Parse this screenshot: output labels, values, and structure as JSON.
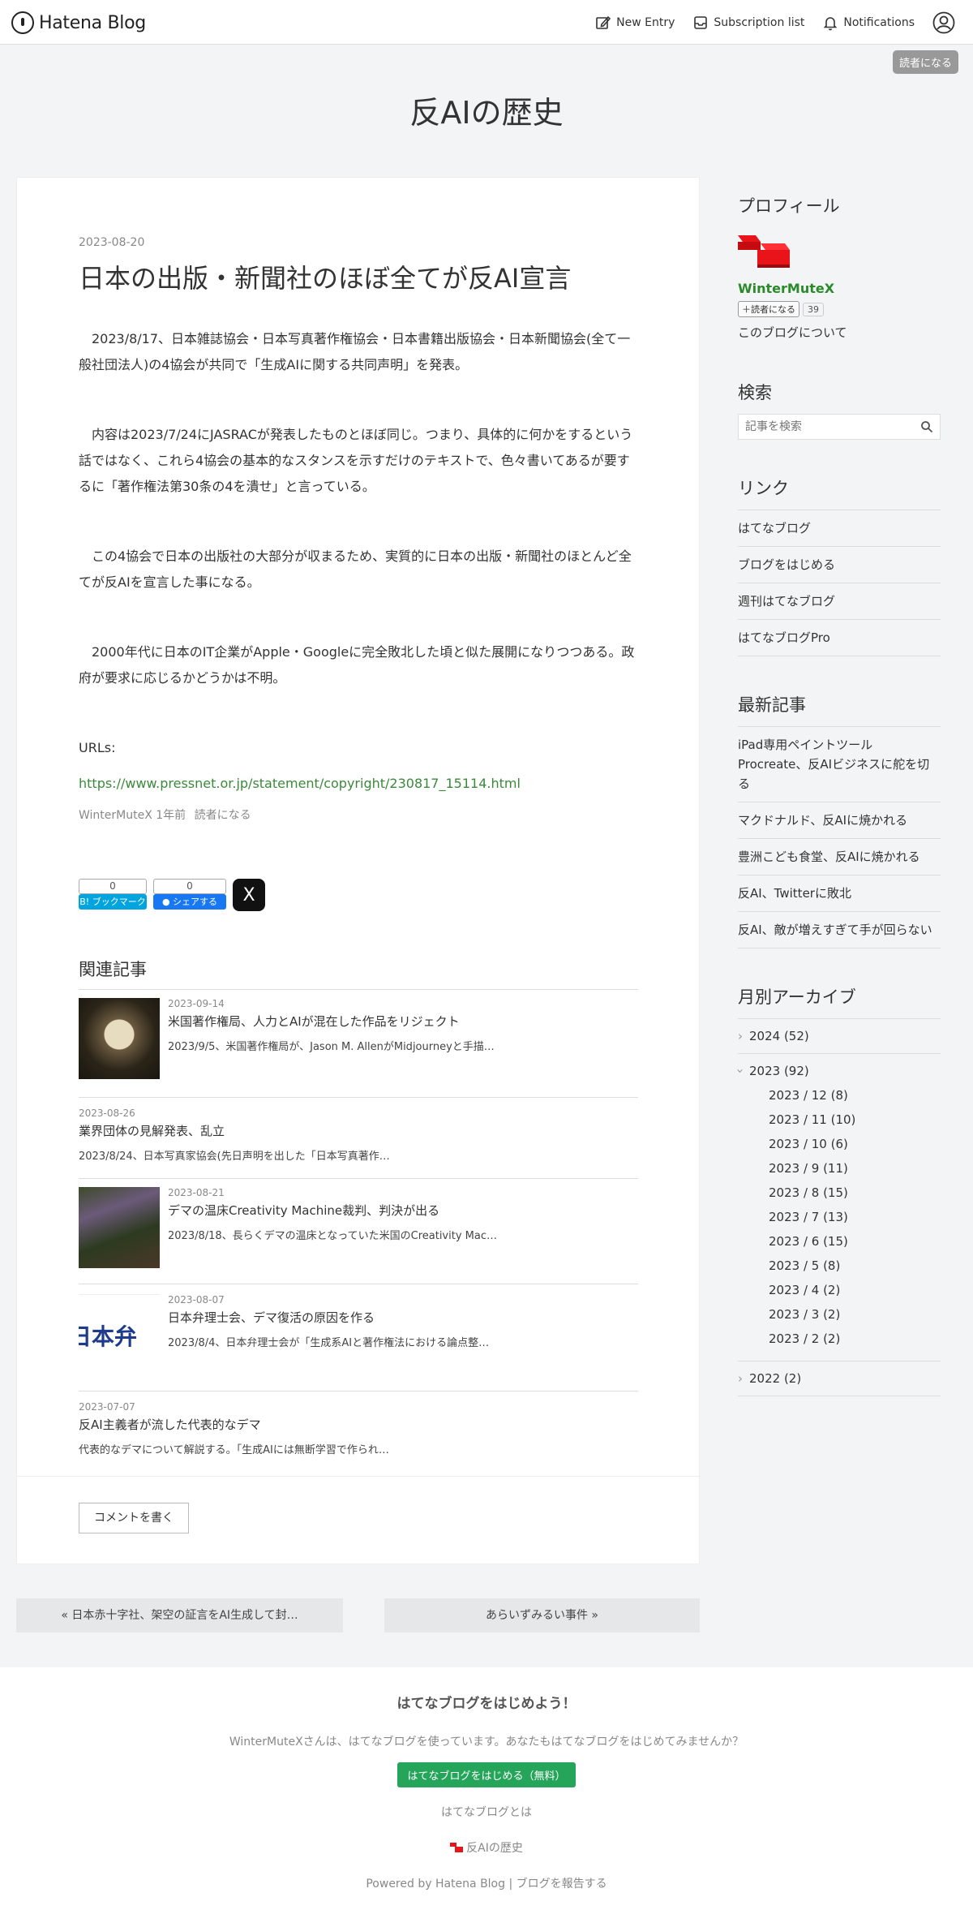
{
  "header": {
    "logo": "Hatena Blog",
    "new_entry": "New Entry",
    "subscription_list": "Subscription list",
    "notifications": "Notifications"
  },
  "subscribe_float": "読者になる",
  "blog_title": "反AIの歴史",
  "entry": {
    "date": "2023-08-20",
    "title": "日本の出版・新聞社のほぼ全てが反AI宣言",
    "paragraphs": [
      "　2023/8/17、日本雑誌協会・日本写真著作権協会・日本書籍出版協会・日本新聞協会(全て一般社団法人)の4協会が共同で「生成AIに関する共同声明」を発表。",
      "　内容は2023/7/24にJASRACが発表したものとほぼ同じ。つまり、具体的に何かをするという話ではなく、これら4協会の基本的なスタンスを示すだけのテキストで、色々書いてあるが要するに「著作権法第30条の4を潰せ」と言っている。",
      "　この4協会で日本の出版社の大部分が収まるため、実質的に日本の出版・新聞社のほとんど全てが反AIを宣言した事になる。",
      "　2000年代に日本のIT企業がApple・Googleに完全敗北した頃と似た展開になりつつある。政府が要求に応じるかどうかは不明。"
    ],
    "urls_label": "URLs:",
    "url": "https://www.pressnet.or.jp/statement/copyright/230817_15114.html",
    "meta_author": "WinterMuteX",
    "meta_time": "1年前",
    "meta_subscribe": "読者になる"
  },
  "share": {
    "bookmark_count": "0",
    "bookmark_label": "B! ブックマーク",
    "facebook_count": "0",
    "facebook_label": "シェアする",
    "x_label": "X"
  },
  "related": {
    "heading": "関連記事",
    "items": [
      {
        "date": "2023-09-14",
        "title": "米国著作権局、人力とAIが混在した作品をリジェクト",
        "desc": "2023/9/5、米国著作権局が、Jason M. AllenがMidjourneyと手描…"
      },
      {
        "date": "2023-08-26",
        "title": "業界団体の見解発表、乱立",
        "desc": "2023/8/24、日本写真家協会(先日声明を出した「日本写真著作…"
      },
      {
        "date": "2023-08-21",
        "title": "デマの温床Creativity Machine裁判、判決が出る",
        "desc": "2023/8/18、長らくデマの温床となっていた米国のCreativity Mac…"
      },
      {
        "date": "2023-08-07",
        "title": "日本弁理士会、デマ復活の原因を作る",
        "desc": "2023/8/4、日本弁理士会が「生成系AIと著作権法における論点整…",
        "thumb_text": "日本弁"
      },
      {
        "date": "2023-07-07",
        "title": "反AI主義者が流した代表的なデマ",
        "desc": "代表的なデマについて解説する。「生成AIには無断学習で作られ…"
      }
    ]
  },
  "comment_button": "コメントを書く",
  "pager": {
    "prev": "« 日本赤十字社、架空の証言をAI生成して封…",
    "next": "あらいずみるい事件 »"
  },
  "sidebar": {
    "profile_heading": "プロフィール",
    "profile_name": "WinterMuteX",
    "subscribe_btn": "読者になる",
    "subscribe_count": "39",
    "about": "このブログについて",
    "search_heading": "検索",
    "search_placeholder": "記事を検索",
    "links_heading": "リンク",
    "links": [
      "はてなブログ",
      "ブログをはじめる",
      "週刊はてなブログ",
      "はてなブログPro"
    ],
    "recent_heading": "最新記事",
    "recent": [
      "iPad専用ペイントツールProcreate、反AIビジネスに舵を切る",
      "マクドナルド、反AIに焼かれる",
      "豊洲こども食堂、反AIに焼かれる",
      "反AI、Twitterに敗北",
      "反AI、敵が増えすぎて手が回らない"
    ],
    "archive_heading": "月別アーカイブ",
    "archive": {
      "y2024": "2024 (52)",
      "y2023": "2023 (92)",
      "months2023": [
        "2023 / 12 (8)",
        "2023 / 11 (10)",
        "2023 / 10 (6)",
        "2023 / 9 (11)",
        "2023 / 8 (15)",
        "2023 / 7 (13)",
        "2023 / 6 (15)",
        "2023 / 5 (8)",
        "2023 / 4 (2)",
        "2023 / 3 (2)",
        "2023 / 2 (2)"
      ],
      "y2022": "2022 (2)"
    }
  },
  "footer": {
    "headline": "はてなブログをはじめよう！",
    "desc": "WinterMuteXさんは、はてなブログを使っています。あなたもはてなブログをはじめてみませんか？",
    "cta": "はてなブログをはじめる（無料）",
    "what": "はてなブログとは",
    "blog_name": "反AIの歴史",
    "powered": "Powered by Hatena Blog | ブログを報告する"
  },
  "colors": {
    "accent_green": "#25a55a",
    "link_green": "#3a8a3a",
    "profile_red": "#e8141a"
  }
}
